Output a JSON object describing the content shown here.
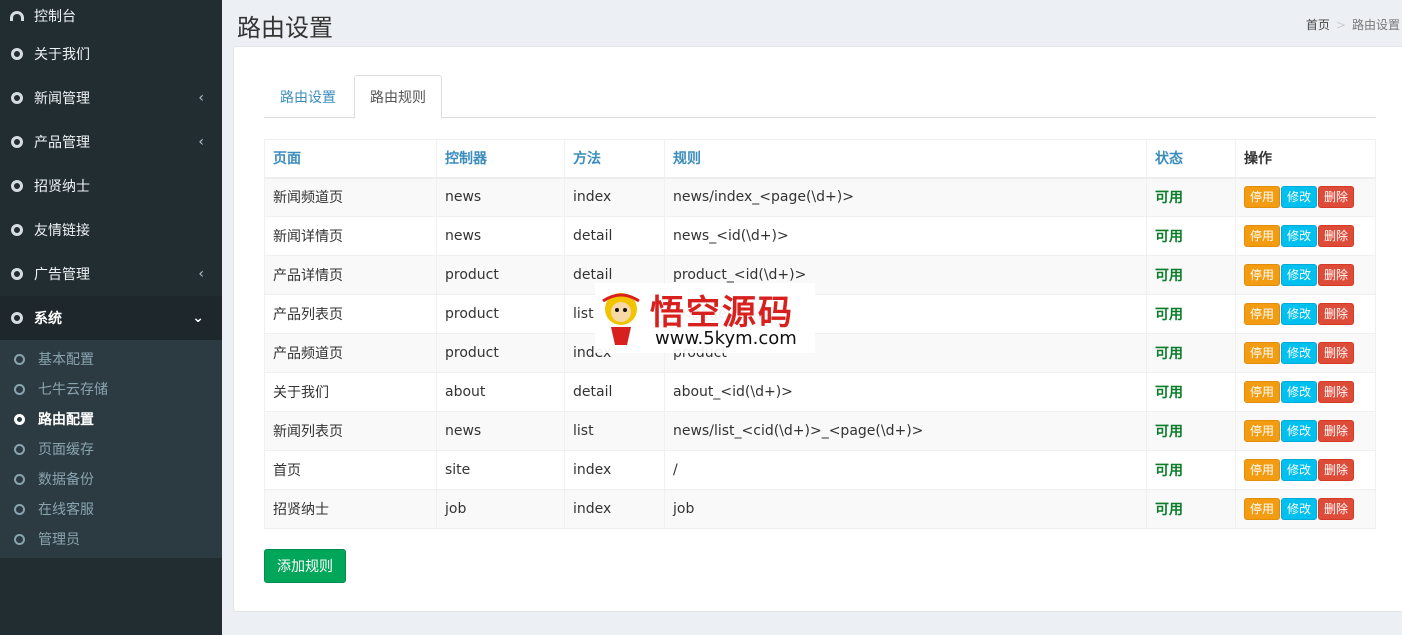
{
  "sidebar": {
    "items": [
      {
        "label": "控制台",
        "icon": "dashboard-icon",
        "chevron": ""
      },
      {
        "label": "关于我们",
        "icon": "circle-icon",
        "chevron": ""
      },
      {
        "label": "新闻管理",
        "icon": "circle-icon",
        "chevron": "‹"
      },
      {
        "label": "产品管理",
        "icon": "circle-icon",
        "chevron": "‹"
      },
      {
        "label": "招贤纳士",
        "icon": "circle-icon",
        "chevron": ""
      },
      {
        "label": "友情链接",
        "icon": "circle-icon",
        "chevron": ""
      },
      {
        "label": "广告管理",
        "icon": "circle-icon",
        "chevron": "‹"
      },
      {
        "label": "系统",
        "icon": "circle-icon",
        "chevron": "⌄"
      }
    ],
    "subitems": [
      {
        "label": "基本配置"
      },
      {
        "label": "七牛云存储"
      },
      {
        "label": "路由配置"
      },
      {
        "label": "页面缓存"
      },
      {
        "label": "数据备份"
      },
      {
        "label": "在线客服"
      },
      {
        "label": "管理员"
      }
    ]
  },
  "header": {
    "title": "路由设置",
    "breadcrumb": {
      "home": "首页",
      "separator": ">",
      "current": "路由设置"
    }
  },
  "tabs": [
    {
      "label": "路由设置"
    },
    {
      "label": "路由规则"
    }
  ],
  "table": {
    "headers": [
      "页面",
      "控制器",
      "方法",
      "规则",
      "状态",
      "操作"
    ],
    "rows": [
      {
        "page": "新闻频道页",
        "controller": "news",
        "method": "index",
        "rule": "news/index_<page(\\d+)>",
        "status": "可用"
      },
      {
        "page": "新闻详情页",
        "controller": "news",
        "method": "detail",
        "rule": "news_<id(\\d+)>",
        "status": "可用"
      },
      {
        "page": "产品详情页",
        "controller": "product",
        "method": "detail",
        "rule": "product_<id(\\d+)>",
        "status": "可用"
      },
      {
        "page": "产品列表页",
        "controller": "product",
        "method": "list",
        "rule": "_<page(\\d+)>",
        "status": "可用"
      },
      {
        "page": "产品频道页",
        "controller": "product",
        "method": "index",
        "rule": "product",
        "status": "可用"
      },
      {
        "page": "关于我们",
        "controller": "about",
        "method": "detail",
        "rule": "about_<id(\\d+)>",
        "status": "可用"
      },
      {
        "page": "新闻列表页",
        "controller": "news",
        "method": "list",
        "rule": "news/list_<cid(\\d+)>_<page(\\d+)>",
        "status": "可用"
      },
      {
        "page": "首页",
        "controller": "site",
        "method": "index",
        "rule": "/",
        "status": "可用"
      },
      {
        "page": "招贤纳士",
        "controller": "job",
        "method": "index",
        "rule": "job",
        "status": "可用"
      }
    ],
    "actions": {
      "disable": "停用",
      "edit": "修改",
      "delete": "删除"
    }
  },
  "add_button": "添加规则",
  "watermark": {
    "title": "悟空源码",
    "url": "www.5kym.com"
  },
  "colors": {
    "sidebar_bg": "#222d32",
    "link": "#3c8dbc",
    "success": "#00a65a",
    "warning": "#f39c12",
    "info": "#00c0ef",
    "danger": "#dd4b39"
  }
}
